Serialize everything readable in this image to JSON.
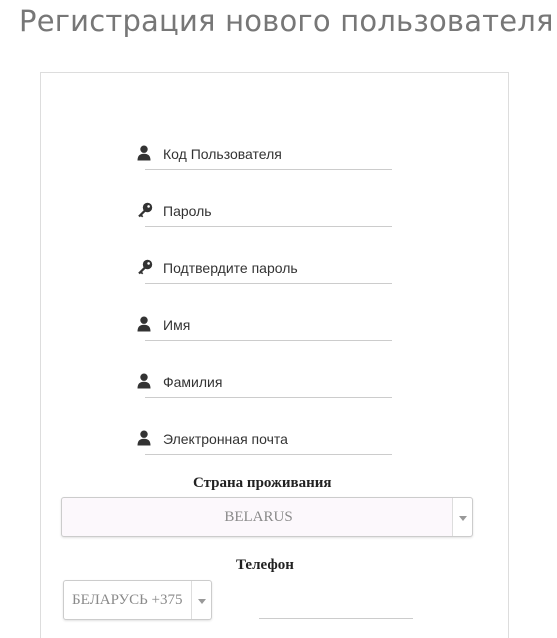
{
  "page": {
    "title": "Регистрация нового пользователя"
  },
  "form": {
    "fields": [
      {
        "placeholder": "Код Пользователя",
        "value": "",
        "icon": "user-icon"
      },
      {
        "placeholder": "Пароль",
        "value": "",
        "icon": "key-icon"
      },
      {
        "placeholder": "Подтвердите пароль",
        "value": "",
        "icon": "key-icon"
      },
      {
        "placeholder": "Имя",
        "value": "",
        "icon": "user-icon"
      },
      {
        "placeholder": "Фамилия",
        "value": "",
        "icon": "user-icon"
      },
      {
        "placeholder": "Электронная почта",
        "value": "",
        "icon": "user-icon"
      }
    ],
    "country": {
      "label": "Страна проживания",
      "selected": "BELARUS"
    },
    "phone": {
      "label": "Телефон",
      "code_selected": "БЕЛАРУСЬ +375",
      "number_value": ""
    }
  },
  "colors": {
    "title": "#777777",
    "icon": "#333333",
    "panel_border": "#dddddd",
    "field_underline": "#cccccc",
    "select_background": "#fcf8fc",
    "select_text": "#8a8a8a"
  }
}
